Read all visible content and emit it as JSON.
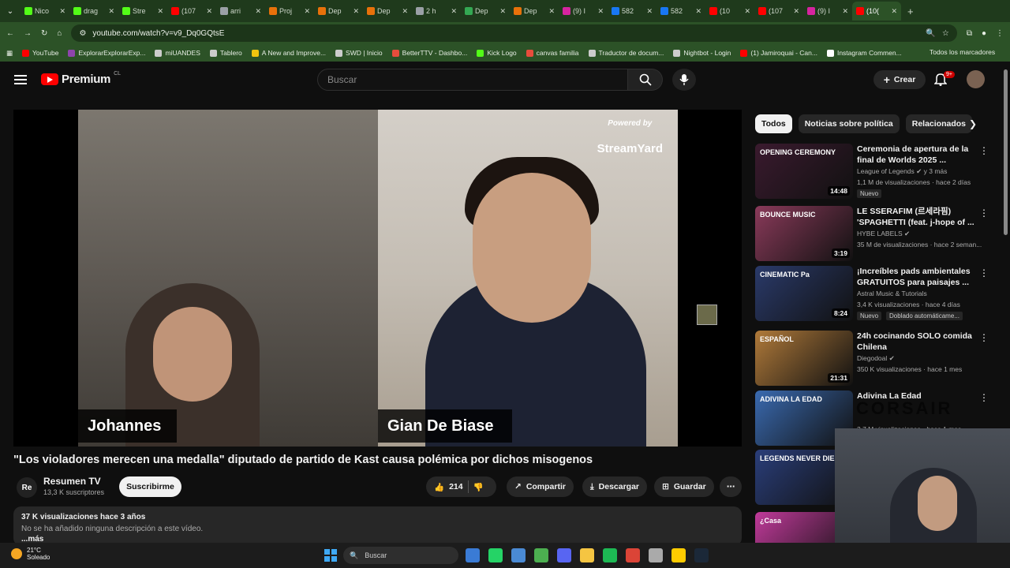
{
  "browser": {
    "tabs": [
      {
        "label": "Nico",
        "color": "#53fc18"
      },
      {
        "label": "drag",
        "color": "#53fc18"
      },
      {
        "label": "Stre",
        "color": "#53fc18"
      },
      {
        "label": "(107",
        "color": "#ff0000"
      },
      {
        "label": "arri",
        "color": "#9aa0a6"
      },
      {
        "label": "Proj",
        "color": "#e8710a"
      },
      {
        "label": "Dep",
        "color": "#e8710a"
      },
      {
        "label": "Dep",
        "color": "#e8710a"
      },
      {
        "label": "2 h",
        "color": "#9aa0a6"
      },
      {
        "label": "Dep",
        "color": "#34a853"
      },
      {
        "label": "Dep",
        "color": "#e8710a"
      },
      {
        "label": "(9) I",
        "color": "#d6249f"
      },
      {
        "label": "582",
        "color": "#1877f2"
      },
      {
        "label": "582",
        "color": "#1877f2"
      },
      {
        "label": "(10",
        "color": "#ff0000"
      },
      {
        "label": "(107",
        "color": "#ff0000"
      },
      {
        "label": "(9) I",
        "color": "#d6249f"
      },
      {
        "label": "(10(",
        "color": "#ff0000"
      }
    ],
    "url": "youtube.com/watch?v=v9_Dq0GQtsE",
    "bookmarks": [
      {
        "label": "YouTube",
        "color": "#ff0000"
      },
      {
        "label": "ExplorarExplorarExp...",
        "color": "#8e44ad"
      },
      {
        "label": "miUANDES",
        "color": "#cccccc"
      },
      {
        "label": "Tablero",
        "color": "#cccccc"
      },
      {
        "label": "A New and Improve...",
        "color": "#f1c40f"
      },
      {
        "label": "SWD | Inicio",
        "color": "#cccccc"
      },
      {
        "label": "BetterTTV - Dashbo...",
        "color": "#e74c3c"
      },
      {
        "label": "Kick Logo",
        "color": "#53fc18"
      },
      {
        "label": "canvas familia",
        "color": "#e74c3c"
      },
      {
        "label": "Traductor de docum...",
        "color": "#cccccc"
      },
      {
        "label": "Nightbot - Login",
        "color": "#cccccc"
      },
      {
        "label": "(1) Jamiroquai - Can...",
        "color": "#ff0000"
      },
      {
        "label": "Instagram Commen...",
        "color": "#ffffff"
      }
    ],
    "all_bookmarks": "Todos los marcadores"
  },
  "youtube": {
    "logo_text": "Premium",
    "country": "CL",
    "search_placeholder": "Buscar",
    "create_label": "Crear",
    "notif_count": "9+"
  },
  "video": {
    "powered_by": "Powered by",
    "streamyard": "StreamYard",
    "left_name": "Johannes",
    "right_name": "Gian De Biase",
    "title": "\"Los violadores merecen una medalla\" diputado de partido de Kast causa polémica por dichos misogenos",
    "channel": "Resumen TV",
    "channel_initials": "Re",
    "subscribers": "13,3 K suscriptores",
    "subscribe_label": "Suscribirme",
    "likes": "214",
    "share_label": "Compartir",
    "download_label": "Descargar",
    "save_label": "Guardar",
    "views_date": "37 K visualizaciones  hace 3 años",
    "no_description": "No se ha añadido ninguna descripción a este vídeo.",
    "more_label": "...más"
  },
  "chips": [
    "Todos",
    "Noticias sobre política",
    "Relacionados"
  ],
  "recommendations": [
    {
      "title": "Ceremonia de apertura de la final de Worlds 2025 ...",
      "channel": "League of Legends",
      "verified": true,
      "extra": "y 3 más",
      "stats": "1,1 M de visualizaciones · hace 2 días",
      "duration": "14:48",
      "badge": "Nuevo",
      "thumb": "#3a1a2e",
      "thumb_text": "OPENING CEREMONY"
    },
    {
      "title": "LE SSERAFIM (르세라핌) 'SPAGHETTI (feat. j-hope of ...",
      "channel": "HYBE LABELS",
      "verified": true,
      "extra": "",
      "stats": "35 M de visualizaciones · hace 2 seman...",
      "duration": "3:19",
      "badge": "",
      "thumb": "#8a3a5a",
      "thumb_text": "BOUNCE MUSIC"
    },
    {
      "title": "¡Increíbles pads ambientales GRATUITOS para paisajes ...",
      "channel": "Astral Music & Tutorials",
      "verified": false,
      "extra": "",
      "stats": "3,4 K visualizaciones · hace 4 días",
      "duration": "8:24",
      "badge": "Nuevo",
      "badge2": "Doblado automáticame...",
      "thumb": "#2a3a6a",
      "thumb_text": "CINEMATIC Pa"
    },
    {
      "title": "24h cocinando SOLO comida Chilena",
      "channel": "Diegodoal",
      "verified": true,
      "extra": "",
      "stats": "350 K visualizaciones · hace 1 mes",
      "duration": "21:31",
      "badge": "",
      "thumb": "#b07a3a",
      "thumb_text": "ESPAÑOL"
    },
    {
      "title": "Adivina La Edad",
      "channel": "",
      "verified": false,
      "extra": "",
      "stats": "3,7 M visualizaciones · hace 1 mes",
      "duration": "2",
      "badge": "",
      "thumb": "#3a6ab0",
      "thumb_text": "ADIVINA LA EDAD"
    },
    {
      "title": "",
      "channel": "",
      "verified": false,
      "extra": "",
      "stats": "",
      "duration": "",
      "badge": "",
      "thumb": "#2a3e7a",
      "thumb_text": "LEGENDS NEVER DIE"
    },
    {
      "title": "",
      "channel": "",
      "verified": false,
      "extra": "",
      "stats": "",
      "duration": "",
      "badge": "",
      "thumb": "#c03a9a",
      "thumb_text": "¿Casa"
    }
  ],
  "overlay": {
    "brand": "CORSAIR"
  },
  "taskbar": {
    "temp": "21°C",
    "weather": "Soleado",
    "search": "Buscar",
    "icons": [
      "#3a7bd5",
      "#25d366",
      "#4a8ad4",
      "#4caf50",
      "#5865f2",
      "#f5c542",
      "#1db954",
      "#db4437",
      "#aaaaaa",
      "#ffcc00",
      "#1b2838"
    ]
  }
}
